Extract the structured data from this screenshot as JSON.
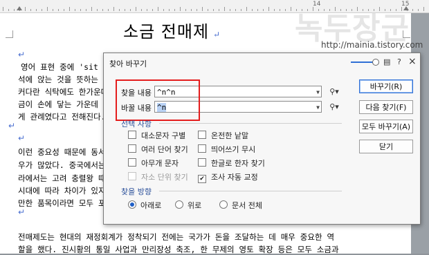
{
  "ruler": {
    "labels": [
      "14",
      "15"
    ]
  },
  "document": {
    "title": "소금 전매제",
    "para_mark": "↵",
    "lines": [
      "영어 표현 중에 'sit ab",
      "석에 앉는 것을 뜻하는 표",
      "커다란 식탁에도 한가운데",
      "금이 손에 닿는 가운데",
      "게 관례였다고 전해진다.",
      "이런 중요성 때문에 동서",
      "우가 많았다. 중국에서는",
      "라에서는 고려 충렬왕 때",
      "시대에 따라 차이가 있지",
      "만한 품목이라면 모두 포",
      "전매제도는 현대의 재정회계가 정착되기 전에는 국가가 돈을 조달하는 데 매우 중요한 역",
      "할을 했다. 진시황의 통일 사업과 만리장성 축조, 한 무제의 영토 확장 등은 모두 소금과"
    ]
  },
  "watermark": {
    "text": "녹두장군",
    "url": "http://mainia.tistory.com"
  },
  "dialog": {
    "title": "찾아 바꾸기",
    "icons": {
      "chat": "message-icon",
      "help": "?",
      "close": "×"
    },
    "find_label": "찾을 내용",
    "find_value": "^n^n",
    "replace_label": "바꿀 내용",
    "replace_value": "^n",
    "options_label": "선택 사항",
    "options": [
      {
        "label": "대소문자 구별",
        "checked": false,
        "disabled": false
      },
      {
        "label": "온전한 낱말",
        "checked": false,
        "disabled": false
      },
      {
        "label": "여러 단어 찾기",
        "checked": false,
        "disabled": false
      },
      {
        "label": "띄어쓰기 무시",
        "checked": false,
        "disabled": false
      },
      {
        "label": "아무개 문자",
        "checked": false,
        "disabled": false
      },
      {
        "label": "한글로 한자 찾기",
        "checked": false,
        "disabled": false
      },
      {
        "label": "자소 단위 찾기",
        "checked": false,
        "disabled": true
      },
      {
        "label": "조사 자동 교정",
        "checked": true,
        "disabled": false
      }
    ],
    "direction_label": "찾을 방향",
    "directions": [
      {
        "label": "아래로",
        "selected": true
      },
      {
        "label": "위로",
        "selected": false
      },
      {
        "label": "문서 전체",
        "selected": false
      }
    ],
    "buttons": {
      "replace": "바꾸기(R)",
      "find_next": "다음 찾기(F)",
      "replace_all": "모두 바꾸기(A)",
      "close": "닫기"
    }
  },
  "colors": {
    "accent": "#2f6fd6",
    "highlight": "#e41c1c",
    "group_label": "#2a4f9a"
  }
}
